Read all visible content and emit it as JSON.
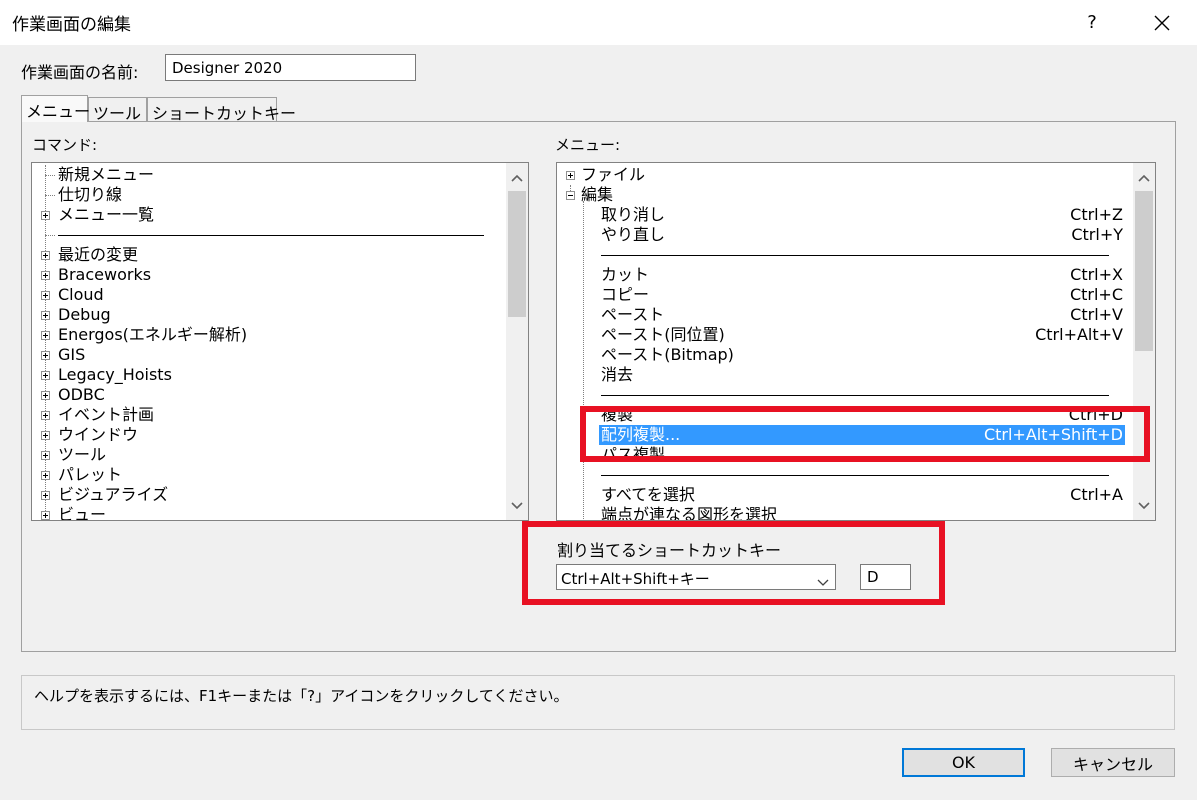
{
  "window": {
    "title": "作業画面の編集",
    "help_glyph": "?"
  },
  "name_field": {
    "label": "作業画面の名前:",
    "value": "Designer 2020"
  },
  "tabs": [
    {
      "label": "メニュー",
      "selected": true
    },
    {
      "label": "ツール",
      "selected": false
    },
    {
      "label": "ショートカットキー",
      "selected": false
    }
  ],
  "commands": {
    "label": "コマンド:",
    "items": [
      {
        "label": "新規メニュー",
        "expandable": false
      },
      {
        "label": "仕切り線",
        "expandable": false
      },
      {
        "label": "メニュー一覧",
        "expandable": true
      },
      {
        "label": "",
        "separator": true
      },
      {
        "label": "最近の変更",
        "expandable": true
      },
      {
        "label": "Braceworks",
        "expandable": true
      },
      {
        "label": "Cloud",
        "expandable": true
      },
      {
        "label": "Debug",
        "expandable": true
      },
      {
        "label": "Energos(エネルギー解析)",
        "expandable": true
      },
      {
        "label": "GIS",
        "expandable": true
      },
      {
        "label": "Legacy_Hoists",
        "expandable": true
      },
      {
        "label": "ODBC",
        "expandable": true
      },
      {
        "label": "イベント計画",
        "expandable": true
      },
      {
        "label": "ウインドウ",
        "expandable": true
      },
      {
        "label": "ツール",
        "expandable": true
      },
      {
        "label": "パレット",
        "expandable": true
      },
      {
        "label": "ビジュアライズ",
        "expandable": true
      },
      {
        "label": "ビュー",
        "expandable": true
      }
    ]
  },
  "menus": {
    "label": "メニュー:",
    "top_items": [
      {
        "label": "ファイル",
        "expanded": false
      },
      {
        "label": "編集",
        "expanded": true
      }
    ],
    "edit_children": [
      {
        "label": "取り消し",
        "shortcut": "Ctrl+Z"
      },
      {
        "label": "やり直し",
        "shortcut": "Ctrl+Y"
      },
      {
        "separator": true
      },
      {
        "label": "カット",
        "shortcut": "Ctrl+X"
      },
      {
        "label": "コピー",
        "shortcut": "Ctrl+C"
      },
      {
        "label": "ペースト",
        "shortcut": "Ctrl+V"
      },
      {
        "label": "ペースト(同位置)",
        "shortcut": "Ctrl+Alt+V"
      },
      {
        "label": "ペースト(Bitmap)",
        "shortcut": ""
      },
      {
        "label": "消去",
        "shortcut": ""
      },
      {
        "separator": true
      },
      {
        "label": "複製",
        "shortcut": "Ctrl+D"
      },
      {
        "label": "配列複製...",
        "shortcut": "Ctrl+Alt+Shift+D",
        "selected": true
      },
      {
        "label": "パス複製",
        "shortcut": ""
      },
      {
        "separator": true
      },
      {
        "label": "すべてを選択",
        "shortcut": "Ctrl+A"
      },
      {
        "label": "端点が連なる図形を選択",
        "shortcut": ""
      }
    ]
  },
  "assign": {
    "label": "割り当てるショートカットキー",
    "modifier_value": "Ctrl+Alt+Shift+キー",
    "key_value": "D"
  },
  "help_text": "ヘルプを表示するには、F1キーまたは「?」アイコンをクリックしてください。",
  "buttons": {
    "ok": "OK",
    "cancel": "キャンセル"
  },
  "colors": {
    "selection": "#3399ff",
    "highlight": "#e81123",
    "default_button_border": "#0078d7"
  },
  "icons": [
    "help-icon",
    "close-icon",
    "chevron-up-icon",
    "chevron-down-icon",
    "expand-icon",
    "collapse-icon",
    "dropdown-arrow-icon"
  ]
}
